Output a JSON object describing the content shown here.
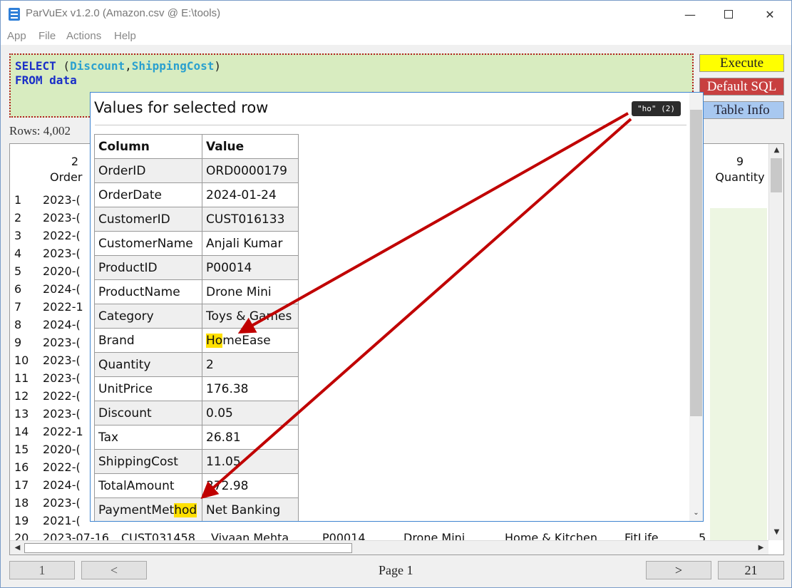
{
  "window": {
    "title": "ParVuEx v1.2.0 (Amazon.csv @ E:\\tools)"
  },
  "menu": [
    "App",
    "File",
    "Actions",
    "Help"
  ],
  "sql": {
    "line1_kw": "SELECT",
    "line1_open": " (",
    "field1": "Discount",
    "comma": ",",
    "field2": "ShippingCost",
    "line1_close": ")",
    "line2_kw": "FROM",
    "line2_table": " data"
  },
  "buttons": {
    "execute": "Execute",
    "default_sql": "Default SQL",
    "table_info": "Table Info"
  },
  "rows_label": "Rows: 4,002",
  "grid": {
    "col1_header_num": "2",
    "col1_header_name": "Order",
    "col9_header_num": "9",
    "col9_header_name": "Quantity",
    "rows": [
      {
        "n": "1",
        "c1": "2023-("
      },
      {
        "n": "2",
        "c1": "2023-("
      },
      {
        "n": "3",
        "c1": "2022-("
      },
      {
        "n": "4",
        "c1": "2023-("
      },
      {
        "n": "5",
        "c1": "2020-("
      },
      {
        "n": "6",
        "c1": "2024-("
      },
      {
        "n": "7",
        "c1": "2022-1"
      },
      {
        "n": "8",
        "c1": "2024-("
      },
      {
        "n": "9",
        "c1": "2023-("
      },
      {
        "n": "10",
        "c1": "2023-("
      },
      {
        "n": "11",
        "c1": "2023-("
      },
      {
        "n": "12",
        "c1": "2022-("
      },
      {
        "n": "13",
        "c1": "2023-("
      },
      {
        "n": "14",
        "c1": "2022-1"
      },
      {
        "n": "15",
        "c1": "2020-("
      },
      {
        "n": "16",
        "c1": "2022-("
      },
      {
        "n": "17",
        "c1": "2024-("
      },
      {
        "n": "18",
        "c1": "2023-("
      },
      {
        "n": "19",
        "c1": "2021-("
      }
    ],
    "last_row": {
      "n": "20",
      "date": "2023-07-16",
      "cust": "CUST031458",
      "name": "Vivaan Mehta",
      "prod": "P00014",
      "pname": "Drone Mini",
      "cat": "Home & Kitchen",
      "brand": "FitLife",
      "qty": "5"
    }
  },
  "pager": {
    "first": "1",
    "prev": "<",
    "page_label": "Page 1",
    "next": ">",
    "last": "21"
  },
  "dialog": {
    "title": "Values for selected row",
    "search_badge": "\"ho\" (2)",
    "headers": {
      "column": "Column",
      "value": "Value"
    },
    "rows": [
      {
        "column": "OrderID",
        "value": "ORD0000179"
      },
      {
        "column": "OrderDate",
        "value": "2024-01-24"
      },
      {
        "column": "CustomerID",
        "value": "CUST016133"
      },
      {
        "column": "CustomerName",
        "value": "Anjali Kumar"
      },
      {
        "column": "ProductID",
        "value": "P00014"
      },
      {
        "column": "ProductName",
        "value": "Drone Mini"
      },
      {
        "column": "Category",
        "value": "Toys & Games"
      },
      {
        "column": "Brand",
        "value_hl": "Ho",
        "value_rest": "meEase"
      },
      {
        "column": "Quantity",
        "value": "2"
      },
      {
        "column": "UnitPrice",
        "value": "176.38"
      },
      {
        "column": "Discount",
        "value": "0.05"
      },
      {
        "column": "Tax",
        "value": "26.81"
      },
      {
        "column": "ShippingCost",
        "value": "11.05"
      },
      {
        "column": "TotalAmount",
        "value": "372.98"
      },
      {
        "column_pre": "PaymentMet",
        "column_hl": "hod",
        "value": "Net Banking"
      }
    ]
  },
  "colors": {
    "accent_border": "#3e84d0",
    "highlight": "#ffe000",
    "arrow": "#c00000",
    "execute": "#ffff00",
    "default_sql": "#c84040",
    "table_info": "#a8c8f0",
    "sql_bg": "#d8ecc0"
  }
}
